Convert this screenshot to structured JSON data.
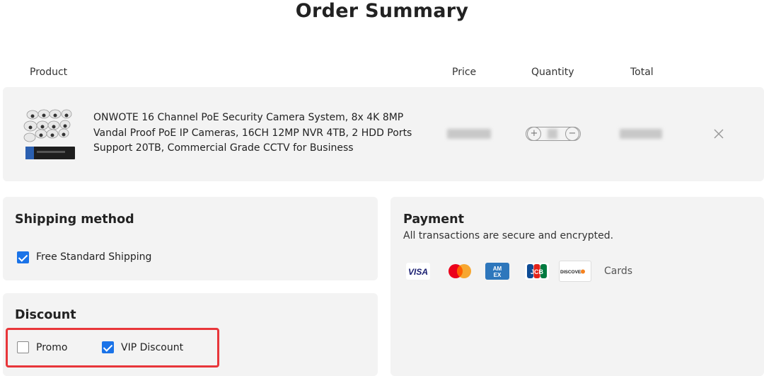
{
  "page": {
    "title": "Order Summary"
  },
  "table_headers": {
    "product": "Product",
    "price": "Price",
    "quantity": "Quantity",
    "total": "Total"
  },
  "cart_item": {
    "name": "ONWOTE 16 Channel PoE Security Camera System, 8x 4K 8MP Vandal Proof PoE IP Cameras, 16CH 12MP NVR 4TB, 2 HDD Ports Support 20TB, Commercial Grade CCTV for Business",
    "remove_icon": "close-icon"
  },
  "shipping": {
    "title": "Shipping method",
    "option_label": "Free Standard Shipping",
    "option_checked": true
  },
  "discount": {
    "title": "Discount",
    "promo_label": "Promo",
    "promo_checked": false,
    "vip_label": "VIP Discount",
    "vip_checked": true
  },
  "payment": {
    "title": "Payment",
    "subtitle": "All transactions are secure and encrypted.",
    "cards_label": "Cards",
    "card_brands": [
      "visa",
      "mastercard",
      "amex",
      "jcb",
      "discover"
    ]
  },
  "colors": {
    "accent": "#1a73e8",
    "highlight": "#e8363a",
    "panel_bg": "#f3f3f3"
  }
}
